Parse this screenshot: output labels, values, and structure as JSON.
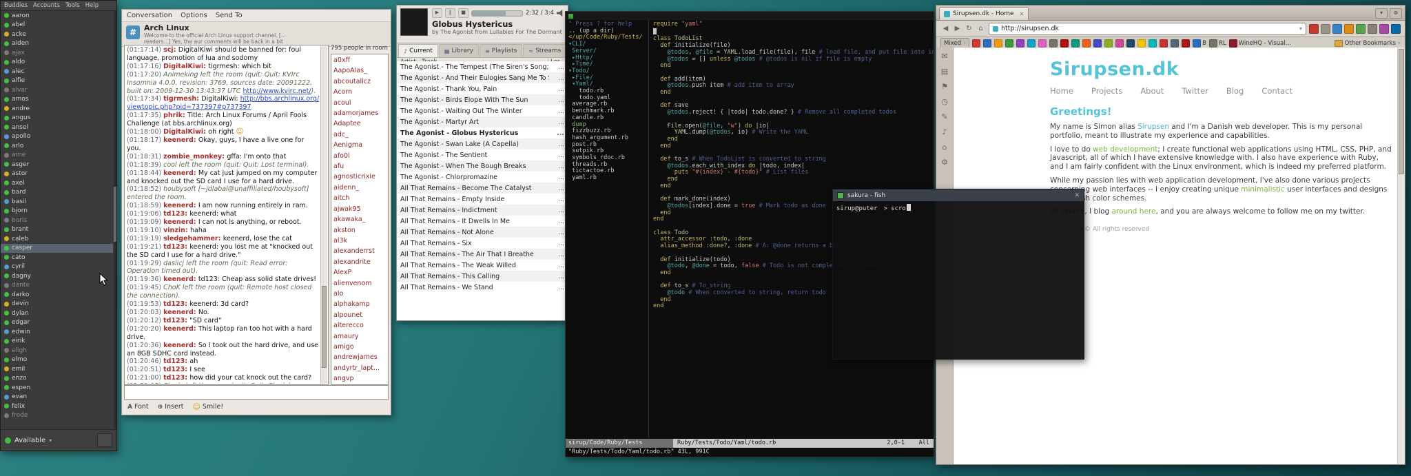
{
  "buddy_list": {
    "menu": [
      "Buddies",
      "Accounts",
      "Tools",
      "Help"
    ],
    "status_label": "Available",
    "items": [
      {
        "n": "aaron",
        "s": "on"
      },
      {
        "n": "abel",
        "s": "on"
      },
      {
        "n": "acke",
        "s": "away"
      },
      {
        "n": "aiden",
        "s": "on"
      },
      {
        "n": "ajax",
        "s": "off"
      },
      {
        "n": "aldo",
        "s": "on"
      },
      {
        "n": "alec",
        "s": "idle"
      },
      {
        "n": "alfie",
        "s": "on"
      },
      {
        "n": "alvar",
        "s": "off"
      },
      {
        "n": "amos",
        "s": "on"
      },
      {
        "n": "andre",
        "s": "away"
      },
      {
        "n": "angus",
        "s": "on"
      },
      {
        "n": "ansel",
        "s": "on"
      },
      {
        "n": "apollo",
        "s": "idle"
      },
      {
        "n": "arlo",
        "s": "on"
      },
      {
        "n": "arne",
        "s": "off"
      },
      {
        "n": "asger",
        "s": "on"
      },
      {
        "n": "astor",
        "s": "away"
      },
      {
        "n": "axel",
        "s": "on"
      },
      {
        "n": "bard",
        "s": "on"
      },
      {
        "n": "basil",
        "s": "idle"
      },
      {
        "n": "bjorn",
        "s": "on"
      },
      {
        "n": "boris",
        "s": "off"
      },
      {
        "n": "brant",
        "s": "on"
      },
      {
        "n": "caleb",
        "s": "away"
      },
      {
        "n": "casper",
        "s": "on",
        "sel": true
      },
      {
        "n": "cato",
        "s": "on"
      },
      {
        "n": "cyril",
        "s": "idle"
      },
      {
        "n": "dagny",
        "s": "on"
      },
      {
        "n": "dante",
        "s": "off"
      },
      {
        "n": "darko",
        "s": "on"
      },
      {
        "n": "devin",
        "s": "away"
      },
      {
        "n": "dylan",
        "s": "on"
      },
      {
        "n": "edgar",
        "s": "on"
      },
      {
        "n": "edwin",
        "s": "idle"
      },
      {
        "n": "eirik",
        "s": "on"
      },
      {
        "n": "eligh",
        "s": "off"
      },
      {
        "n": "elmo",
        "s": "on"
      },
      {
        "n": "emil",
        "s": "away"
      },
      {
        "n": "enzo",
        "s": "on"
      },
      {
        "n": "espen",
        "s": "on"
      },
      {
        "n": "evan",
        "s": "idle"
      },
      {
        "n": "felix",
        "s": "on"
      },
      {
        "n": "frode",
        "s": "off"
      }
    ]
  },
  "conversation": {
    "menu": [
      "Conversation",
      "Options",
      "Send To"
    ],
    "channel": "Arch Linux",
    "topic1": "Welcome to the official Arch Linux support channel. [...",
    "topic2": "readers...] Yes, the aur comments will be back in a bit",
    "people": "795 people in room",
    "toolbar": [
      {
        "icon": "A",
        "label": "Font",
        "icon_name": "font-icon"
      },
      {
        "icon": "⊕",
        "label": "Insert",
        "icon_name": "insert-icon"
      },
      {
        "icon": "☺",
        "label": "Smile!",
        "icon_name": "smile-icon"
      }
    ],
    "messages": [
      {
        "time": "01:17:14",
        "nick": "scj",
        "text": "DigitalKiwi should be banned for: foul language, promotion of lua and sodomy"
      },
      {
        "time": "01:17:16",
        "nick": "DigitalKiwi",
        "text": "tigrmesh: which bit"
      },
      {
        "time": "01:17:20",
        "type": "system",
        "text": "Animeking left the room (quit: Quit: KVIrc Insomnia 4.0.0, revision: 3769, sources date: 20091222, built on: 2009-12-30 13:43:37 UTC ",
        "link": "http://www.kvirc.net/",
        "suffix": ")."
      },
      {
        "time": "01:17:34",
        "nick": "tigrmesh",
        "text": "DigitalKiwi: ",
        "link": "http://bbs.archlinux.org/viewtopic.php?pid=737397#p737397"
      },
      {
        "time": "01:17:35",
        "nick": "phrik",
        "text": "Title: Arch Linux Forums / April Fools Challenge (at bbs.archlinux.org)"
      },
      {
        "time": "01:18:00",
        "nick": "DigitalKiwi",
        "text": "oh right ",
        "emote": "☺"
      },
      {
        "time": "01:18:17",
        "nick": "keenerd",
        "text": "Okay, guys, I have a live one for you."
      },
      {
        "time": "01:18:31",
        "nick": "zombie_monkey",
        "text": "gffa: I'm onto that"
      },
      {
        "time": "01:18:39",
        "type": "system",
        "text": "cool left the room (quit: Quit: Lost terminal)."
      },
      {
        "time": "01:18:44",
        "nick": "keenerd",
        "text": "My cat just jumped on my computer and knocked out the SD card I use for a hard drive."
      },
      {
        "time": "01:18:52",
        "type": "system",
        "text": "houbysoft [~jdlabal@unaffiliated/houbysoft] entered the room."
      },
      {
        "time": "01:18:59",
        "nick": "keenerd",
        "text": "I am now running entirely in ram."
      },
      {
        "time": "01:19:06",
        "nick": "td123",
        "text": "keenerd: what"
      },
      {
        "time": "01:19:09",
        "nick": "keenerd",
        "text": "I can not ls anything, or reboot."
      },
      {
        "time": "01:19:10",
        "nick": "vinzin",
        "text": "haha"
      },
      {
        "time": "01:19:19",
        "nick": "sledgehammer",
        "text": "keenerd, lose the cat"
      },
      {
        "time": "01:19:21",
        "nick": "td123",
        "text": "keenerd: you lost me at \"knocked out the SD card I use for a hard drive.\""
      },
      {
        "time": "01:19:29",
        "type": "system",
        "text": "daslicj left the room (quit: Read error: Operation timed out)."
      },
      {
        "time": "01:19:36",
        "nick": "keenerd",
        "text": "td123: Cheap ass solid state drives!"
      },
      {
        "time": "01:19:45",
        "type": "system",
        "text": "ChoK left the room (quit: Remote host closed the connection)."
      },
      {
        "time": "01:19:53",
        "nick": "td123",
        "text": "keenerd: 3d card?"
      },
      {
        "time": "01:20:03",
        "nick": "keenerd",
        "text": "No."
      },
      {
        "time": "01:20:12",
        "nick": "td123",
        "text": "\"SD card\""
      },
      {
        "time": "01:20:20",
        "nick": "keenerd",
        "text": "This laptop ran too hot with a hard drive."
      },
      {
        "time": "01:20:36",
        "nick": "keenerd",
        "text": "So I took out the hard drive, and use an 8GB SDHC card instead."
      },
      {
        "time": "01:20:46",
        "nick": "td123",
        "text": "ah"
      },
      {
        "time": "01:20:51",
        "nick": "td123",
        "text": "I see"
      },
      {
        "time": "01:21:00",
        "nick": "td123",
        "text": "how did your cat knock out the card?"
      },
      {
        "time": "01:21:03",
        "type": "system",
        "text": "Shyde left the room (quit: Quit: Shyde)."
      }
    ],
    "users": [
      "a0xff",
      "AapoAlas_",
      "abcoutallcz",
      "Acorn",
      "acoul",
      "adamorjames",
      "Adaptee",
      "adc_",
      "Aenigma",
      "afo0l",
      "afu",
      "agnosticrixie",
      "aidenn_",
      "aitch",
      "ajwak95",
      "akawaka_",
      "akston",
      "al3k",
      "alexanderrst",
      "alexandrite",
      "AlexP",
      "alienvenom",
      "alo",
      "alphakamp",
      "alpounet",
      "alterecco",
      "amaury",
      "amigo",
      "andrewjames",
      "andyrtr_lapt...",
      "angvp"
    ]
  },
  "player": {
    "time": "2:32 / 3:4",
    "title": "Globus Hystericus",
    "subtitle": "by The Agonist from Lullabies For The Dormant Mi",
    "progress_pct": 67,
    "tabs": [
      {
        "label": "Current",
        "icon": "♪",
        "active": true
      },
      {
        "label": "Library",
        "icon": "▦",
        "active": false
      },
      {
        "label": "Playlists",
        "icon": "≡",
        "active": false
      },
      {
        "label": "Streams",
        "icon": "≈",
        "active": false
      }
    ],
    "columns": [
      "Artist - Track",
      "Ler"
    ],
    "tracks": [
      {
        "t": "The Agonist - The Tempest (The Siren's Song; The B...",
        "len": "...",
        "current": false
      },
      {
        "t": "The Agonist - And Their Eulogies Sang Me To Sleep",
        "len": "...",
        "current": false
      },
      {
        "t": "The Agonist - Thank You, Pain",
        "len": "...",
        "current": false
      },
      {
        "t": "The Agonist - Birds Elope With The Sun",
        "len": "...",
        "current": false
      },
      {
        "t": "The Agonist - Waiting Out The Winter",
        "len": "...",
        "current": false
      },
      {
        "t": "The Agonist - Martyr Art",
        "len": "...",
        "current": false
      },
      {
        "t": "The Agonist - Globus Hystericus",
        "len": "...",
        "current": true
      },
      {
        "t": "The Agonist - Swan Lake (A Capella)",
        "len": "...",
        "current": false
      },
      {
        "t": "The Agonist - The Sentient",
        "len": "...",
        "current": false
      },
      {
        "t": "The Agonist - When The Bough Breaks",
        "len": "...",
        "current": false
      },
      {
        "t": "The Agonist - Chlorpromazine",
        "len": "...",
        "current": false
      },
      {
        "t": "All That Remains - Become The Catalyst",
        "len": "...",
        "current": false
      },
      {
        "t": "All That Remains - Empty Inside",
        "len": "...",
        "current": false
      },
      {
        "t": "All That Remains - Indictment",
        "len": "...",
        "current": false
      },
      {
        "t": "All That Remains - It Dwells In Me",
        "len": "...",
        "current": false
      },
      {
        "t": "All That Remains - Not Alone",
        "len": "...",
        "current": false
      },
      {
        "t": "All That Remains - Six",
        "len": "...",
        "current": false
      },
      {
        "t": "All That Remains - The Air That I Breathe",
        "len": "...",
        "current": false
      },
      {
        "t": "All That Remains - The Weak Willed",
        "len": "...",
        "current": false
      },
      {
        "t": "All That Remains - This Calling",
        "len": "...",
        "current": false
      },
      {
        "t": "All That Remains - We Stand",
        "len": "...",
        "current": false
      }
    ]
  },
  "vim": {
    "tree": [
      {
        "t": "\" Press ? for help",
        "c": "help"
      },
      {
        "t": ".. (up a dir)",
        "c": "up"
      },
      {
        "t": "</up/Code/Ruby/Tests/",
        "c": "root"
      },
      {
        "t": "▾CLI/",
        "c": "dir"
      },
      {
        "t": " Server/",
        "c": "dir"
      },
      {
        "t": " ▸Http/",
        "c": "dir"
      },
      {
        "t": " ▸Time/",
        "c": "dir"
      },
      {
        "t": "▾Todo/",
        "c": "dir"
      },
      {
        "t": " ▸File/",
        "c": "dir"
      },
      {
        "t": " ▾Yaml/",
        "c": "dir"
      },
      {
        "t": "   todo.rb",
        "c": "file"
      },
      {
        "t": "   todo.yaml",
        "c": "file"
      },
      {
        "t": " average.rb",
        "c": "file"
      },
      {
        "t": " benchmark.rb",
        "c": "file"
      },
      {
        "t": " candle.rb",
        "c": "file"
      },
      {
        "t": " dump",
        "c": "exec"
      },
      {
        "t": " fizzbuzz.rb",
        "c": "file"
      },
      {
        "t": " hash_argument.rb",
        "c": "file"
      },
      {
        "t": " post.rb",
        "c": "file"
      },
      {
        "t": " sutpik.rb",
        "c": "file"
      },
      {
        "t": " symbols_rdoc.rb",
        "c": "file"
      },
      {
        "t": " threads.rb",
        "c": "file"
      },
      {
        "t": " tictactoe.rb",
        "c": "file"
      },
      {
        "t": " yaml.rb",
        "c": "file"
      }
    ],
    "code": [
      "require \"yaml\"",
      "",
      "class TodoList",
      "  def initialize(file)",
      "    @todos, @file = YAML.load_file(file), file # load file, and put file into ins",
      "    @todos = [] unless @todos # @todos is nil if file is empty",
      "  end",
      "",
      "  def add(item)",
      "    @todos.push item # add item to array",
      "  end",
      "",
      "  def save",
      "    @todos.reject! { |todo| todo.done? } # Remove all completed todos",
      "",
      "    File.open(@file, \"w\") do |io|",
      "      YAML.dump(@todos, io) # Write the YAML",
      "    end",
      "  end",
      "",
      "  def to_s # When TodoList is converted to string",
      "    @todos.each_with_index do |todo, index|",
      "      puts \"#{index} - #{todo}\" # List files",
      "    end",
      "  end",
      "",
      "  def mark_done(index)",
      "    @todos[index].done = true # Mark todo as done",
      "  end",
      "end",
      "",
      "class Todo",
      "  attr_accessor :todo, :done",
      "  alias_method :done?, :done # A: @done returns a boolean value",
      "",
      "  def initialize(todo)",
      "    @todo, @done = todo, false # Todo is not completed once added",
      "  end",
      "",
      "  def to_s # To_string",
      "    @todo # When converted to string, return todo",
      "  end",
      "end"
    ],
    "status_left": "sirup/Code/Ruby/Tests",
    "status_file": "Ruby/Tests/Todo/Yaml/todo.rb",
    "status_pos": "2,0-1",
    "status_all": "All",
    "cmdline": "\"Ruby/Tests/Todo/Yaml/todo.rb\" 43L, 991C"
  },
  "sakura": {
    "title": "sakura - fish",
    "prompt": "sirup@puter",
    "arrow": ">",
    "typed": "scro"
  },
  "browser": {
    "tab": {
      "title": "Sirupsen.dk - Home"
    },
    "tabbar_buttons": [
      {
        "g": "▾",
        "n": "tab-list-icon"
      },
      {
        "g": "⊗",
        "n": "closed-tabs-icon"
      }
    ],
    "nav_buttons": [
      {
        "g": "◀",
        "n": "back-button"
      },
      {
        "g": "▶",
        "n": "forward-button"
      },
      {
        "g": "↻",
        "n": "reload-button"
      },
      {
        "g": "⌂",
        "n": "home-button"
      }
    ],
    "url": "http://sirupsen.dk",
    "ext_colors": [
      "#c23b2e",
      "#999489",
      "#3884c4",
      "#e08a16",
      "#58a34e",
      "#8a8478",
      "#a44ba4",
      "#0a6aa8"
    ],
    "bookmarks": {
      "mixed": "Mixed",
      "favicon_colors": [
        "#d03a30",
        "#2b6fc4",
        "#f29a0c",
        "#3a9a3a",
        "#9340c0",
        "#0aa4c8",
        "#e060c0",
        "#787268",
        "#b01010",
        "#0a9a80",
        "#f06018",
        "#4448c8",
        "#88b022",
        "#d04898",
        "#244668",
        "#f0c400",
        "#08b8b8",
        "#c43434",
        "#566878",
        "#a81818"
      ],
      "labeled": [
        {
          "label": "B",
          "color": "#2b6fc4"
        },
        {
          "label": "RL",
          "color": "#787268"
        },
        {
          "label": "WineHQ - Visual...",
          "color": "#8a1c2c"
        }
      ],
      "other": "Other Bookmarks"
    },
    "sidebar_icons": [
      {
        "g": "✉",
        "n": "mail-panel-icon"
      },
      {
        "g": "▤",
        "n": "bookmarks-panel-icon"
      },
      {
        "g": "⚑",
        "n": "notes-panel-icon"
      },
      {
        "g": "◷",
        "n": "history-panel-icon"
      },
      {
        "g": "✎",
        "n": "links-panel-icon"
      },
      {
        "g": "♪",
        "n": "music-panel-icon"
      },
      {
        "g": "⌂",
        "n": "home-panel-icon"
      },
      {
        "g": "⚙",
        "n": "settings-panel-icon"
      }
    ],
    "page": {
      "title": "Sirupsen.dk",
      "accent": "#54c3d6",
      "nav": [
        "Home",
        "Projects",
        "About",
        "Twitter",
        "Blog",
        "Contact"
      ],
      "greeting": "Greetings!",
      "p1": [
        {
          "t": "My name is Simon alias "
        },
        {
          "t": "Sirupsen",
          "c": "#4db4c8",
          "link": true
        },
        {
          "t": " and I'm a Danish web developer. This is my personal portfolio, meant to illustrate my experience and capabilities."
        }
      ],
      "p2": [
        {
          "t": "I love to do "
        },
        {
          "t": "web development",
          "c": "#79b33e",
          "link": true
        },
        {
          "t": "; I create functional web applications using HTML, CSS, PHP, and Javascript, all of which I have extensive knowledge with. I also have experience with Ruby, and I am fairly confident with the Linux environment, which is indeed my preferred platform."
        }
      ],
      "p3": [
        {
          "t": "While my passion lies with web application development, I've also done various projects concerning web interfaces -- I enjoy creating unique "
        },
        {
          "t": "minimalistic",
          "c": "#79b33e",
          "link": true
        },
        {
          "t": " user interfaces and designs using fresh color schemes."
        }
      ],
      "p4": [
        {
          "t": "Of course, I blog "
        },
        {
          "t": "around here",
          "c": "#79b33e",
          "link": true
        },
        {
          "t": ", and you are always welcome to follow me on my twitter."
        }
      ],
      "footer": "© All rights reserved"
    }
  }
}
